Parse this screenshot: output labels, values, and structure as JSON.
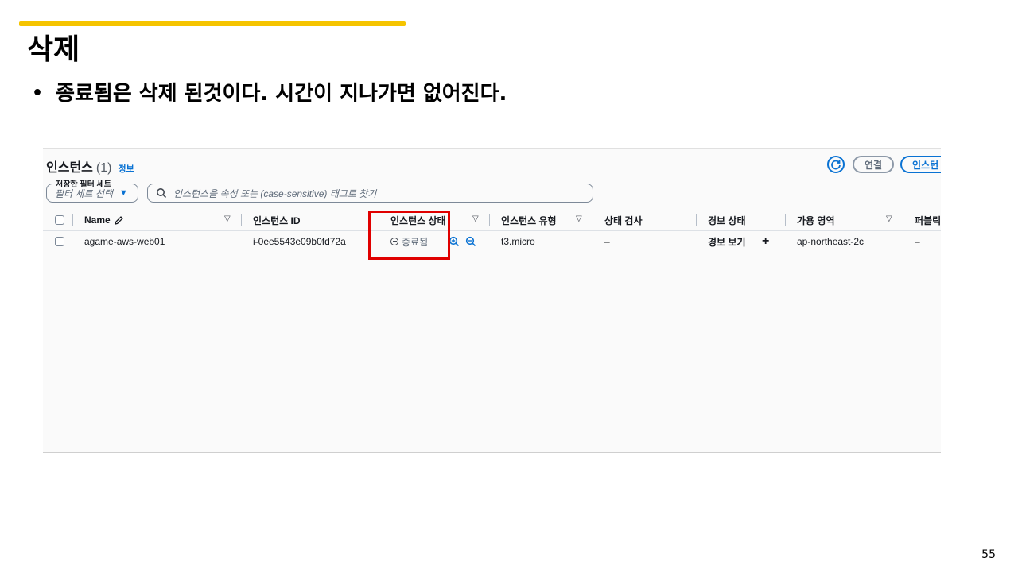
{
  "slide": {
    "title": "삭제",
    "bullet": "종료됨은 삭제 된것이다. 시간이 지나가면 없어진다.",
    "page_number": "55",
    "accent_color": "#f5c400",
    "highlight_color": "#e00000"
  },
  "console": {
    "title": "인스턴스",
    "count": "(1)",
    "info_link": "정보",
    "buttons": {
      "refresh_icon": "refresh-icon",
      "connect": "연결",
      "launch": "인스턴"
    },
    "filter": {
      "legend": "저장한 필터 세트",
      "placeholder": "필터 세트 선택"
    },
    "search": {
      "placeholder": "인스턴스을 속성 또는 (case-sensitive) 태그로 찾기"
    },
    "columns": {
      "name": "Name",
      "instance_id": "인스턴스 ID",
      "state": "인스턴스 상태",
      "type": "인스턴스 유형",
      "status_check": "상태 검사",
      "alarm": "경보 상태",
      "az": "가용 영역",
      "public": "퍼블릭"
    },
    "rows": [
      {
        "name": "agame-aws-web01",
        "instance_id": "i-0ee5543e09b0fd72a",
        "state": "종료됨",
        "type": "t3.micro",
        "status_check": "–",
        "alarm": "경보 보기",
        "alarm_add": "+",
        "az": "ap-northeast-2c",
        "public": "–"
      }
    ]
  }
}
